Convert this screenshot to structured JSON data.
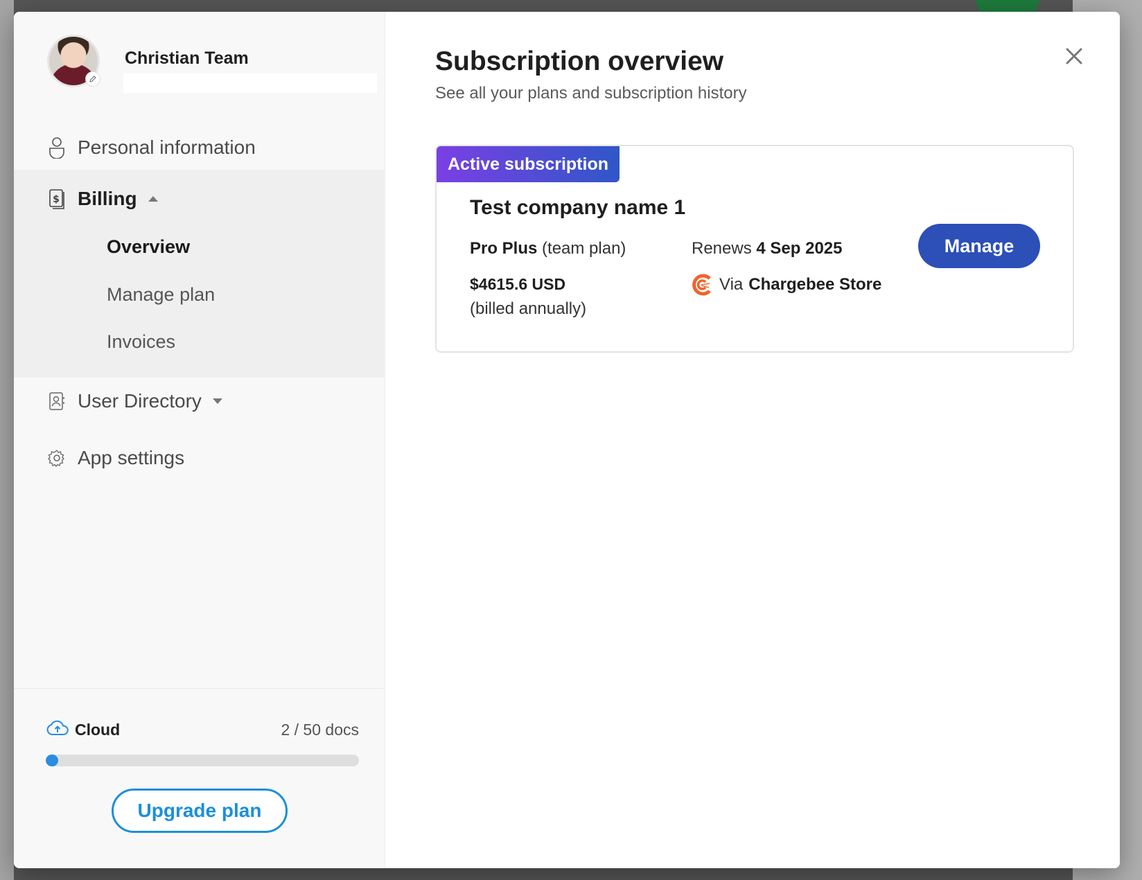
{
  "profile": {
    "name": "Christian Team"
  },
  "nav": {
    "personal": "Personal information",
    "billing": "Billing",
    "billing_items": [
      "Overview",
      "Manage plan",
      "Invoices"
    ],
    "user_directory": "User Directory",
    "app_settings": "App settings"
  },
  "storage": {
    "label": "Cloud",
    "count": "2 / 50 docs",
    "used_fraction": 0.04,
    "upgrade_label": "Upgrade plan"
  },
  "main": {
    "title": "Subscription overview",
    "subtitle": "See all your plans and subscription history"
  },
  "subscription": {
    "badge": "Active subscription",
    "company": "Test company name 1",
    "plan_name": "Pro Plus",
    "plan_type": "(team plan)",
    "renews_prefix": "Renews",
    "renews_date": "4 Sep 2025",
    "price": "$4615.6 USD",
    "billing_note": "(billed annually)",
    "via_prefix": "Via",
    "store": "Chargebee Store",
    "manage_label": "Manage"
  },
  "colors": {
    "accent_blue": "#2c4fb8",
    "upgrade_blue": "#1c8fd8",
    "badge_purple": "#7b3fe4",
    "chargebee_orange": "#f0642c"
  }
}
